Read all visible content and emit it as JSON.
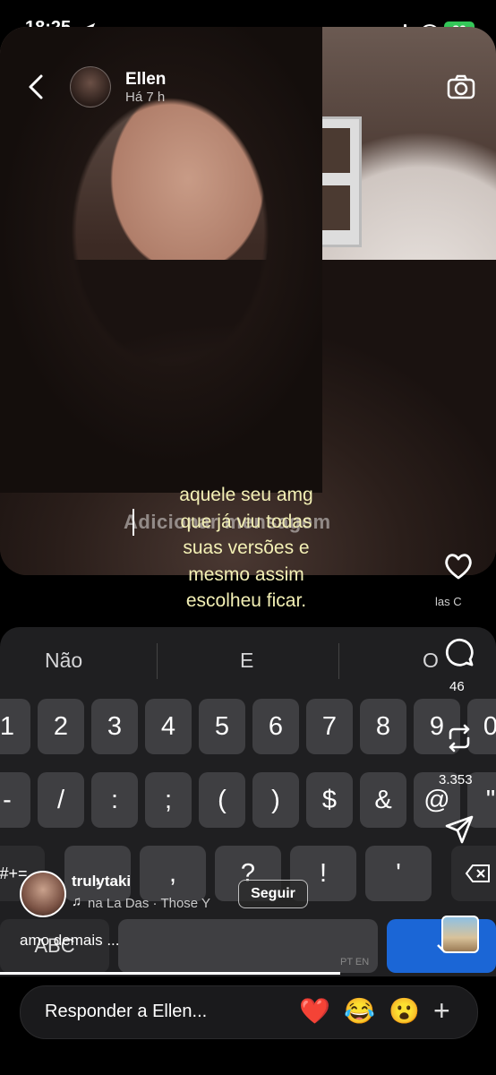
{
  "status": {
    "time": "18:25",
    "battery": "82"
  },
  "story": {
    "user": "Ellen",
    "time_ago": "Há 7 h",
    "input_placeholder": "Adicionar mensagem",
    "caption_lines": [
      "aquele seu amg",
      "que já viu todas",
      "suas versões e",
      "mesmo assim",
      "escolheu ficar."
    ]
  },
  "side": {
    "likes_label": "las   C",
    "comment_count": "46",
    "repost_count": "3.353"
  },
  "keyboard": {
    "suggestions": [
      "Não",
      "E",
      "O"
    ],
    "row1": [
      "1",
      "2",
      "3",
      "4",
      "5",
      "6",
      "7",
      "8",
      "9",
      "0"
    ],
    "row2": [
      "-",
      "/",
      ":",
      ";",
      "(",
      ")",
      "$",
      "&",
      "@",
      "\""
    ],
    "row3": [
      "#+=",
      ",",
      "?",
      "!",
      "'"
    ],
    "abc": "ABC",
    "language": "PT EN"
  },
  "post": {
    "poster": "trulytaki",
    "music": "na La Das · Those Y",
    "follow": "Seguir",
    "caption": "amo demais ..."
  },
  "reply": {
    "placeholder": "Responder a Ellen...",
    "emojis": [
      "❤️",
      "😂",
      "😮"
    ],
    "plus": "+"
  }
}
